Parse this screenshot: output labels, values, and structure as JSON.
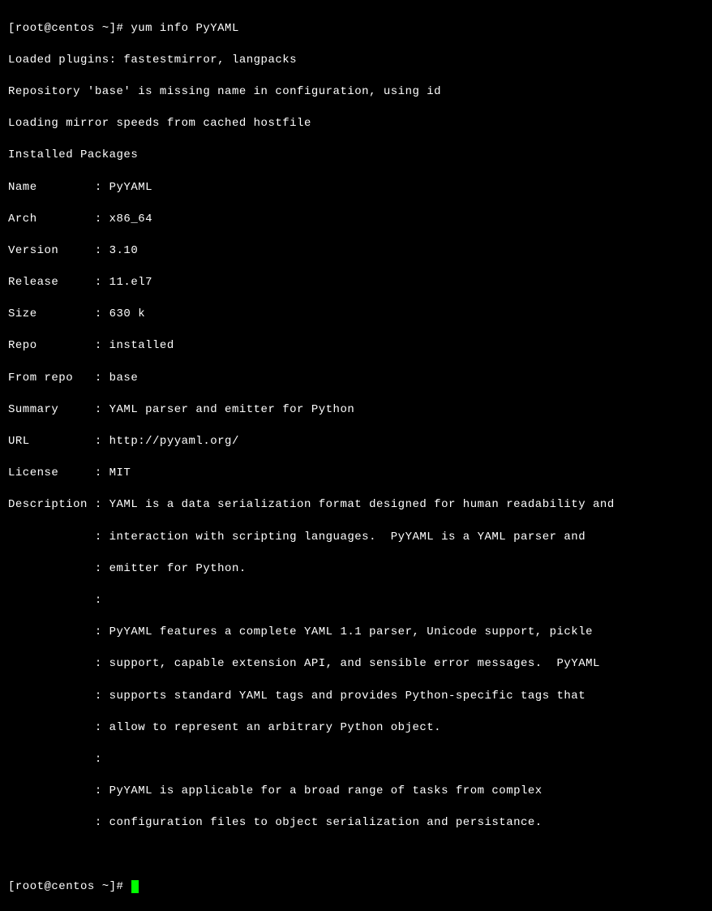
{
  "prompt1": {
    "user_host": "[root@centos ~]#",
    "command": "yum info PyYAML"
  },
  "output": {
    "line1": "Loaded plugins: fastestmirror, langpacks",
    "line2": "Repository 'base' is missing name in configuration, using id",
    "line3": "Loading mirror speeds from cached hostfile",
    "line4": "Installed Packages",
    "fields": {
      "name": "Name        : PyYAML",
      "arch": "Arch        : x86_64",
      "version": "Version     : 3.10",
      "release": "Release     : 11.el7",
      "size": "Size        : 630 k",
      "repo": "Repo        : installed",
      "from_repo": "From repo   : base",
      "summary": "Summary     : YAML parser and emitter for Python",
      "url": "URL         : http://pyyaml.org/",
      "license": "License     : MIT",
      "desc1": "Description : YAML is a data serialization format designed for human readability and",
      "desc2": "            : interaction with scripting languages.  PyYAML is a YAML parser and",
      "desc3": "            : emitter for Python.",
      "desc4": "            :",
      "desc5": "            : PyYAML features a complete YAML 1.1 parser, Unicode support, pickle",
      "desc6": "            : support, capable extension API, and sensible error messages.  PyYAML",
      "desc7": "            : supports standard YAML tags and provides Python-specific tags that",
      "desc8": "            : allow to represent an arbitrary Python object.",
      "desc9": "            :",
      "desc10": "            : PyYAML is applicable for a broad range of tasks from complex",
      "desc11": "            : configuration files to object serialization and persistance."
    }
  },
  "prompt2": {
    "user_host": "[root@centos ~]#"
  }
}
